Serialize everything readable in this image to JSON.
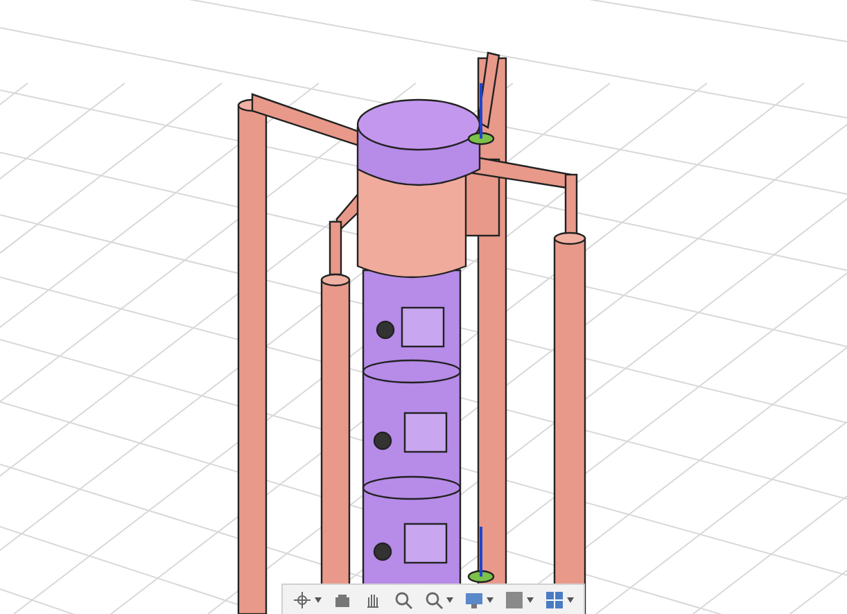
{
  "toolbar": {
    "tools": [
      {
        "kind": "orbit",
        "dropdown": true
      },
      {
        "kind": "look",
        "dropdown": false
      },
      {
        "kind": "pan",
        "dropdown": false
      },
      {
        "kind": "zoom",
        "dropdown": false
      },
      {
        "kind": "fit",
        "dropdown": true
      },
      {
        "kind": "display",
        "dropdown": true
      },
      {
        "kind": "style",
        "dropdown": true
      },
      {
        "kind": "grid",
        "dropdown": true
      }
    ]
  }
}
